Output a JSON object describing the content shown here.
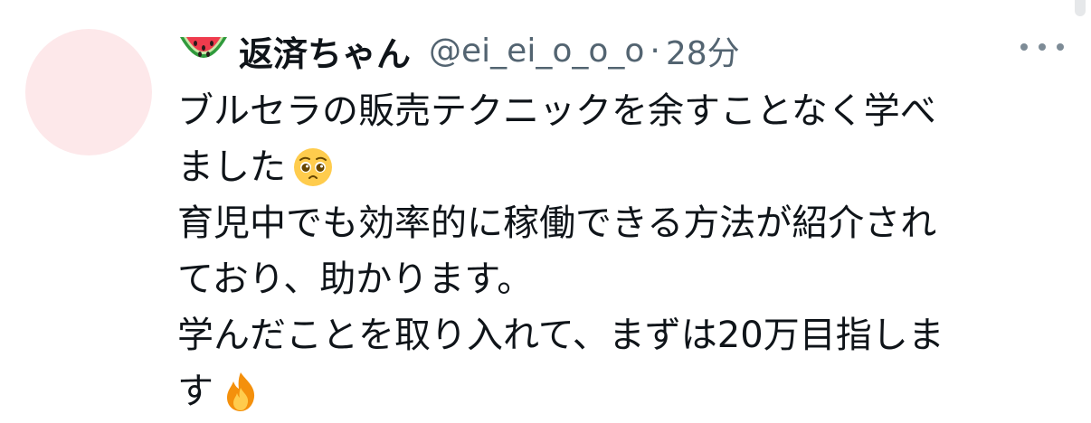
{
  "tweet": {
    "author": {
      "emoji": "watermelon",
      "display_name": "返済ちゃん",
      "handle": "@ei_ei_o_o_o",
      "separator": "·",
      "time": "28分"
    },
    "lines": [
      "ブルセラの販売テクニックを余すことなく学べ",
      "ました",
      "育児中でも効率的に稼働できる方法が紹介され",
      "ており、助かります。",
      "学んだことを取り入れて、まずは20万目指しま",
      "す"
    ],
    "inline_emojis": [
      "pleading-face",
      "fire"
    ]
  },
  "icons": {
    "more": "more-horizontal-icon"
  },
  "colors": {
    "text": "#0f1419",
    "secondary": "#536471",
    "avatar_bg": "#fde8ea",
    "icon": "#7d8b96"
  }
}
